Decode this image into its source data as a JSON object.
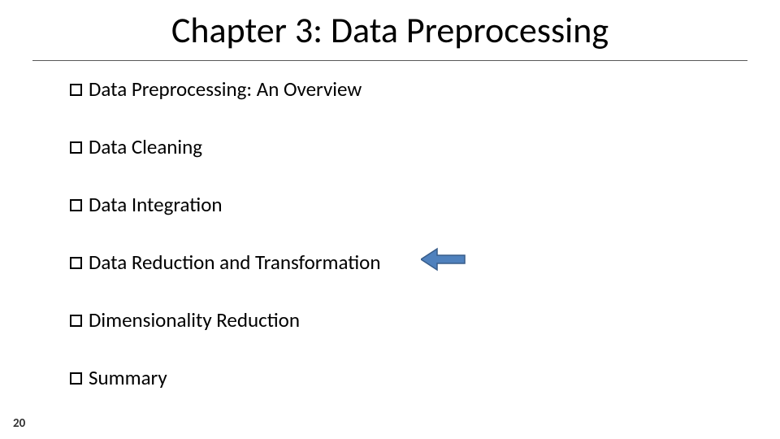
{
  "title": "Chapter 3: Data Preprocessing",
  "bullets": [
    {
      "label": "Data Preprocessing: An Overview"
    },
    {
      "label": "Data Cleaning"
    },
    {
      "label": "Data Integration"
    },
    {
      "label": "Data Reduction and Transformation"
    },
    {
      "label": "Dimensionality Reduction"
    },
    {
      "label": "Summary"
    }
  ],
  "pageNumber": "20",
  "arrow": {
    "fill": "#4F81BD",
    "stroke": "#385D8A"
  }
}
